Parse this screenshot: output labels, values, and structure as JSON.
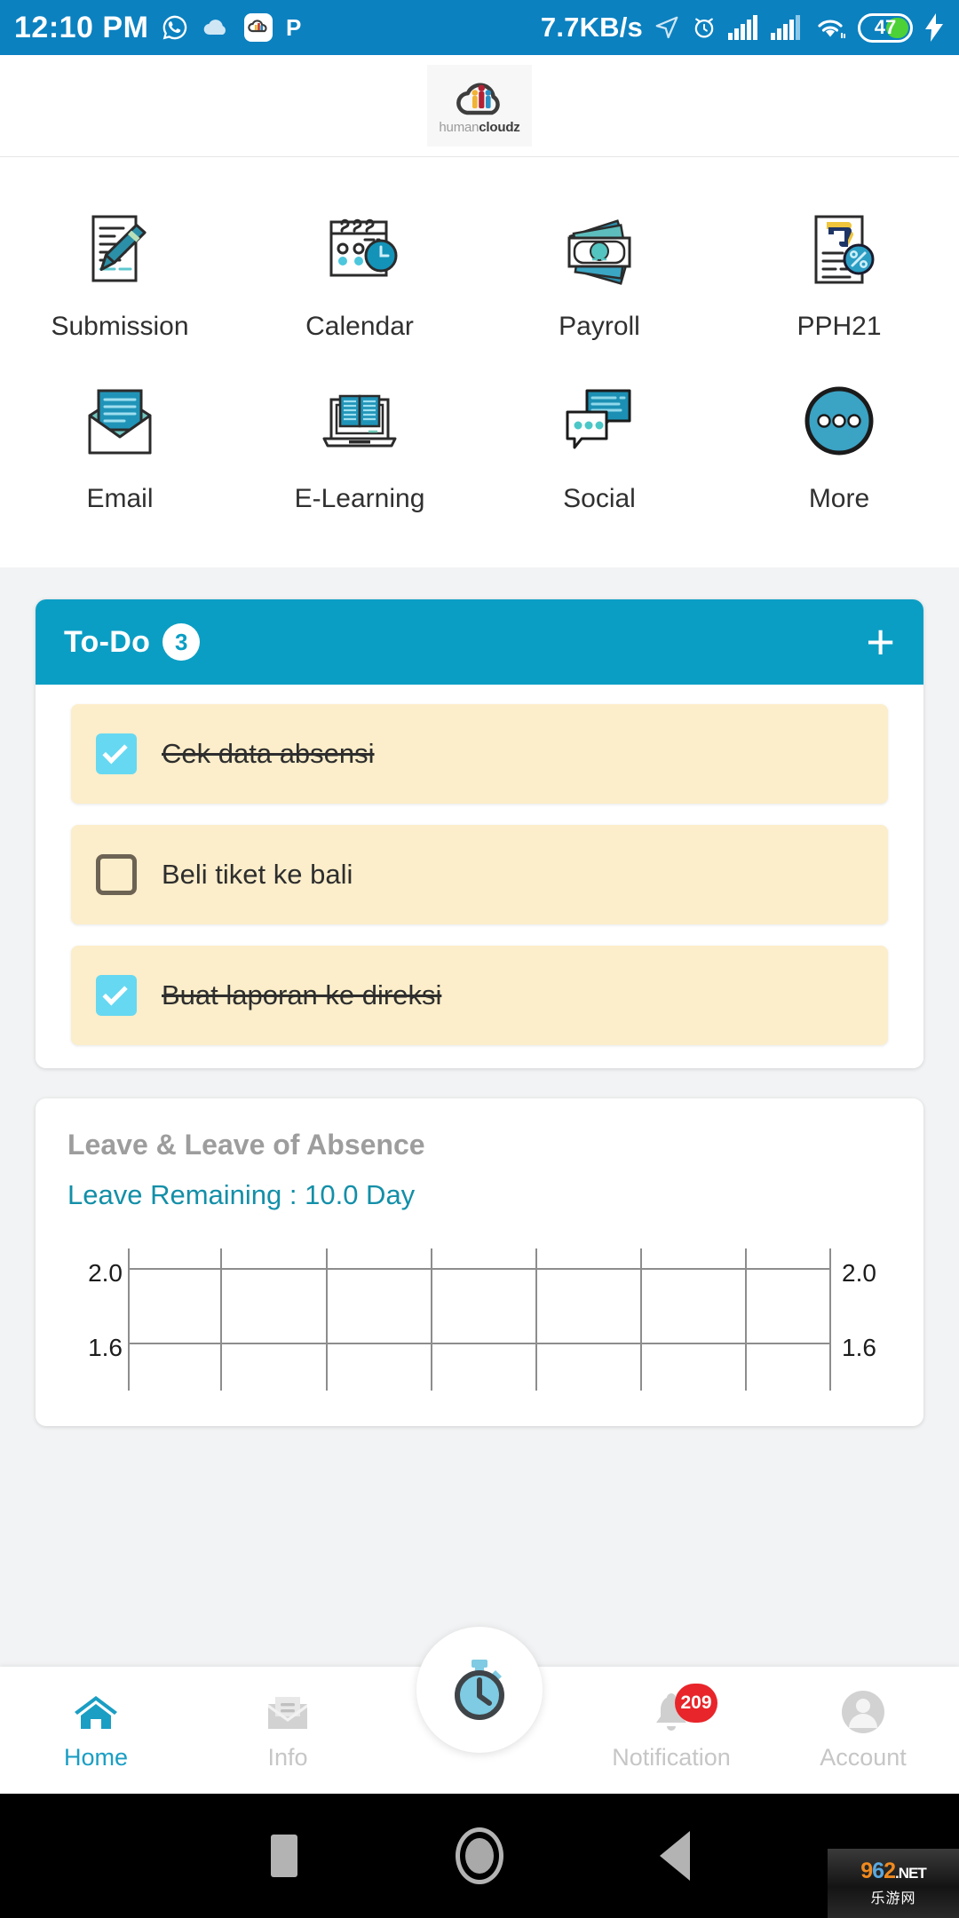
{
  "statusbar": {
    "time": "12:10 PM",
    "network_speed": "7.7KB/s",
    "battery_level": "47",
    "icons": [
      "whatsapp-icon",
      "cloud-icon",
      "humancloudz-app-icon",
      "paypal-icon",
      "location-arrow-icon",
      "alarm-icon",
      "signal-icon-1",
      "signal-icon-2",
      "wifi-icon",
      "battery-icon",
      "charging-bolt-icon"
    ],
    "bar_color": "#0b81c0"
  },
  "header": {
    "logo_text_light": "human",
    "logo_text_bold": "cloudz"
  },
  "shortcuts": [
    {
      "label": "Submission",
      "icon": "document-pen-icon"
    },
    {
      "label": "Calendar",
      "icon": "calendar-clock-icon"
    },
    {
      "label": "Payroll",
      "icon": "money-banknote-icon"
    },
    {
      "label": "PPH21",
      "icon": "tax-document-percent-icon"
    },
    {
      "label": "Email",
      "icon": "envelope-open-icon"
    },
    {
      "label": "E-Learning",
      "icon": "laptop-book-icon"
    },
    {
      "label": "Social",
      "icon": "chat-bubbles-icon"
    },
    {
      "label": "More",
      "icon": "ellipsis-circle-icon"
    }
  ],
  "todo": {
    "title": "To-Do",
    "count": "3",
    "add_label": "+",
    "items": [
      {
        "text": "Cek data absensi",
        "checked": true
      },
      {
        "text": "Beli tiket ke bali",
        "checked": false
      },
      {
        "text": "Buat laporan ke direksi",
        "checked": true
      }
    ]
  },
  "leave": {
    "title": "Leave & Leave of Absence",
    "remaining": "Leave Remaining : 10.0 Day"
  },
  "chart_data": {
    "type": "line",
    "title": "Leave & Leave of Absence",
    "xlabel": "",
    "ylabel": "",
    "y_left_ticks": [
      "2.0",
      "1.6"
    ],
    "y_right_ticks": [
      "2.0",
      "1.6"
    ],
    "ylim": [
      1.6,
      2.2
    ],
    "grid": true,
    "vertical_gridlines": 8,
    "legend": "none",
    "series": [],
    "note": "Chart is cut off at the bottom of the viewport; only the upper gridlines and 2.0 / 1.6 tick labels are visible on both left and right axes."
  },
  "bottomnav": {
    "items": [
      {
        "label": "Home",
        "icon": "home-icon",
        "active": true
      },
      {
        "label": "Info",
        "icon": "envelope-info-icon",
        "active": false
      },
      {
        "label": "Notification",
        "icon": "bell-icon",
        "active": false,
        "badge": "209"
      },
      {
        "label": "Account",
        "icon": "user-avatar-icon",
        "active": false
      }
    ],
    "fab_icon": "stopwatch-icon",
    "active_color": "#1a9ec4",
    "inactive_color": "#c6c6c6",
    "badge_color": "#e8252a"
  },
  "androidnav": {
    "buttons": [
      "recents-square-icon",
      "home-circle-icon",
      "back-triangle-icon"
    ],
    "watermark": {
      "d9": "9",
      "d6": "6",
      "d2": "2",
      "net": ".NET",
      "cn": "乐游网"
    }
  }
}
